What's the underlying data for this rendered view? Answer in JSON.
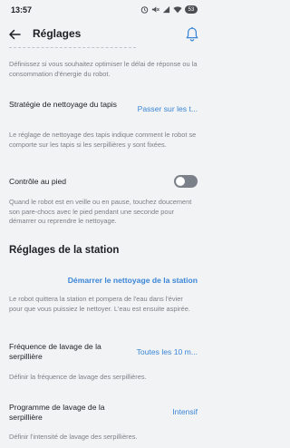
{
  "status_bar": {
    "time": "13:57",
    "battery": "53"
  },
  "header": {
    "title": "Réglages"
  },
  "intro_description": "Définissez si vous souhaitez optimiser le délai de réponse ou la consommation d'énergie du robot.",
  "carpet_strategy": {
    "label": "Stratégie de nettoyage du tapis",
    "value": "Passer sur les t...",
    "description": "Le réglage de nettoyage des tapis indique comment le robot se comporte sur les tapis si les serpillières y sont fixées."
  },
  "foot_control": {
    "label": "Contrôle au pied",
    "enabled": false,
    "description": "Quand le robot est en veille ou en pause, touchez doucement son pare-chocs avec le pied pendant une seconde pour démarrer ou reprendre le nettoyage."
  },
  "station_section": {
    "title": "Réglages de la station",
    "start_cleaning_link": "Démarrer le nettoyage de la station",
    "start_cleaning_description": "Le robot quittera la station et pompera de l'eau dans l'évier pour que vous puissiez le nettoyer. L'eau est ensuite aspirée."
  },
  "mop_wash_frequency": {
    "label": "Fréquence de lavage de la serpillière",
    "value": "Toutes les 10 m...",
    "description": "Définir la fréquence de lavage des serpillières."
  },
  "mop_wash_program": {
    "label": "Programme de lavage de la serpillière",
    "value": "Intensif",
    "description": "Définir l'intensité de lavage des serpillières."
  }
}
